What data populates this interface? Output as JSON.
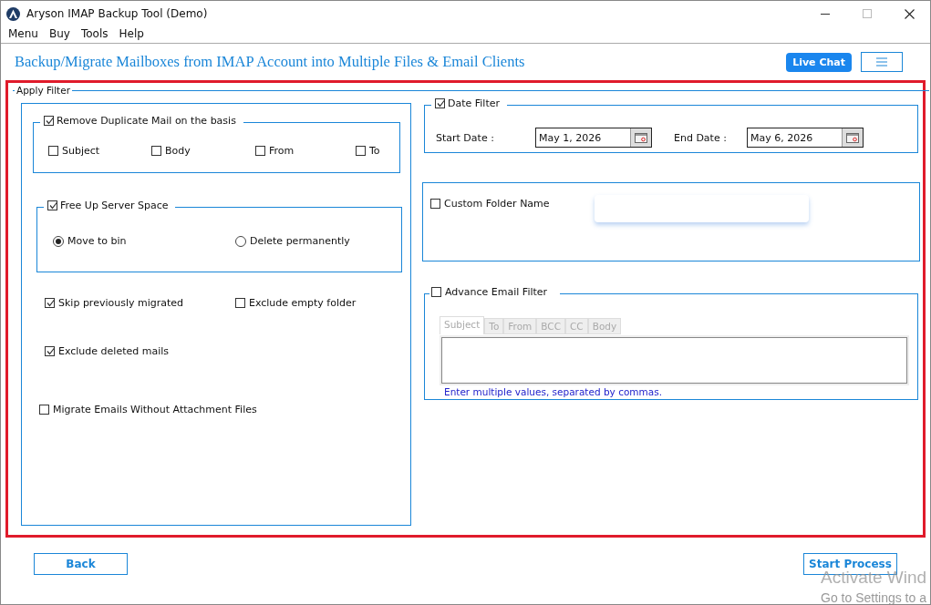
{
  "window": {
    "title": "Aryson IMAP Backup Tool (Demo)"
  },
  "menu": [
    "Menu",
    "Buy",
    "Tools",
    "Help"
  ],
  "header": {
    "title": "Backup/Migrate Mailboxes from IMAP Account into Multiple Files & Email Clients",
    "live_chat": "Live Chat"
  },
  "apply_filter": {
    "title": "Apply Filter",
    "duplicate": {
      "label": "Remove Duplicate Mail on the basis",
      "checked": true,
      "options": [
        {
          "label": "Subject",
          "checked": false
        },
        {
          "label": "Body",
          "checked": false
        },
        {
          "label": "From",
          "checked": false
        },
        {
          "label": "To",
          "checked": false
        }
      ]
    },
    "free_space": {
      "label": "Free Up Server Space",
      "checked": true,
      "options": [
        {
          "label": "Move to bin",
          "selected": true
        },
        {
          "label": "Delete permanently",
          "selected": false
        }
      ]
    },
    "options": [
      {
        "label": "Skip previously migrated",
        "checked": true
      },
      {
        "label": "Exclude empty folder",
        "checked": false
      },
      {
        "label": "Exclude deleted mails",
        "checked": true
      },
      {
        "label": "Migrate Emails Without Attachment Files",
        "checked": false
      }
    ],
    "date_filter": {
      "label": "Date Filter",
      "checked": true,
      "start_label": "Start Date :",
      "start_value": "May 1, 2026",
      "end_label": "End Date :",
      "end_value": "May 6, 2026"
    },
    "custom_folder": {
      "label": "Custom Folder Name",
      "checked": false
    },
    "advance_filter": {
      "label": "Advance Email Filter",
      "checked": false,
      "tabs": [
        {
          "label": "Subject",
          "selected": true
        },
        {
          "label": "To",
          "selected": false
        },
        {
          "label": "From",
          "selected": false
        },
        {
          "label": "BCC",
          "selected": false
        },
        {
          "label": "CC",
          "selected": false
        },
        {
          "label": "Body",
          "selected": false
        }
      ],
      "hint": "Enter multiple values, separated by commas."
    }
  },
  "buttons": {
    "back": "Back",
    "start": "Start Process"
  },
  "os_overlay": {
    "line_1": "Activate Wind",
    "line_2": "Go to Settings to a"
  }
}
